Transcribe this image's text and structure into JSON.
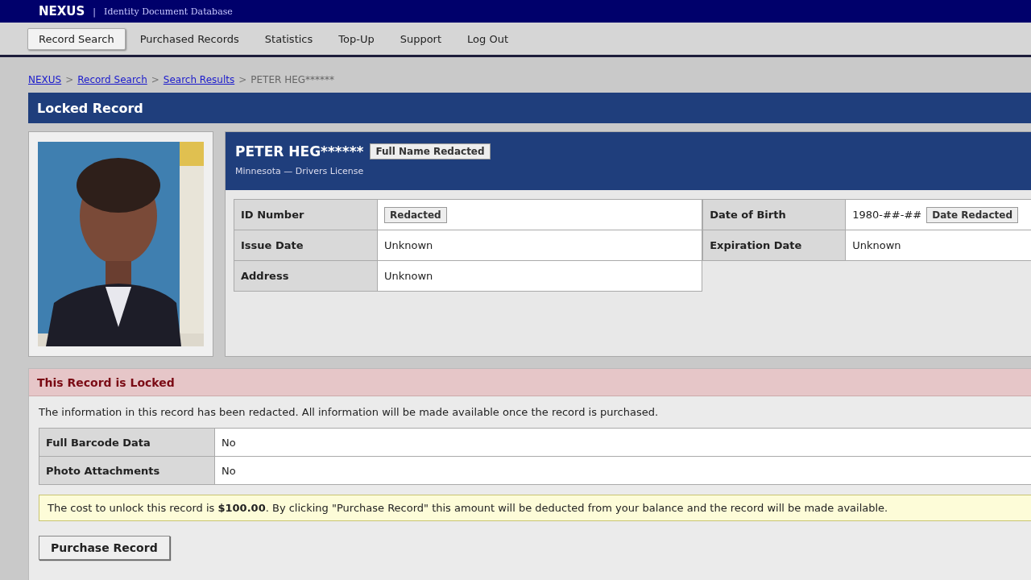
{
  "header": {
    "brand": "NEXUS",
    "separator": "|",
    "subtitle": "Identity Document Database"
  },
  "nav": [
    {
      "label": "Record Search",
      "selected": true
    },
    {
      "label": "Purchased Records",
      "selected": false
    },
    {
      "label": "Statistics",
      "selected": false
    },
    {
      "label": "Top-Up",
      "selected": false
    },
    {
      "label": "Support",
      "selected": false
    },
    {
      "label": "Log Out",
      "selected": false
    }
  ],
  "breadcrumb": {
    "links": [
      "NEXUS",
      "Record Search",
      "Search Results"
    ],
    "separator": ">",
    "current": "PETER HEG******"
  },
  "page_title": "Locked Record",
  "record": {
    "name": "PETER HEG******",
    "name_badge": "Full Name Redacted",
    "subtitle": "Minnesota — Drivers License",
    "fields_left": [
      {
        "label": "ID Number",
        "badge": "Redacted"
      },
      {
        "label": "Issue Date",
        "value": "Unknown"
      },
      {
        "label": "Address",
        "value": "Unknown"
      }
    ],
    "fields_right": [
      {
        "label": "Date of Birth",
        "value": "1980-##-##",
        "badge": "Date Redacted"
      },
      {
        "label": "Expiration Date",
        "value": "Unknown"
      }
    ]
  },
  "locked": {
    "title": "This Record is Locked",
    "message": "The information in this record has been redacted. All information will be made available once the record is purchased.",
    "rows": [
      {
        "label": "Full Barcode Data",
        "value": "No"
      },
      {
        "label": "Photo Attachments",
        "value": "No"
      }
    ],
    "notice": "The cost to unlock this record is **$100.00**. By clicking \"Purchase Record\" this amount will be deducted from your balance and the record will be made available.",
    "button": "Purchase Record"
  }
}
